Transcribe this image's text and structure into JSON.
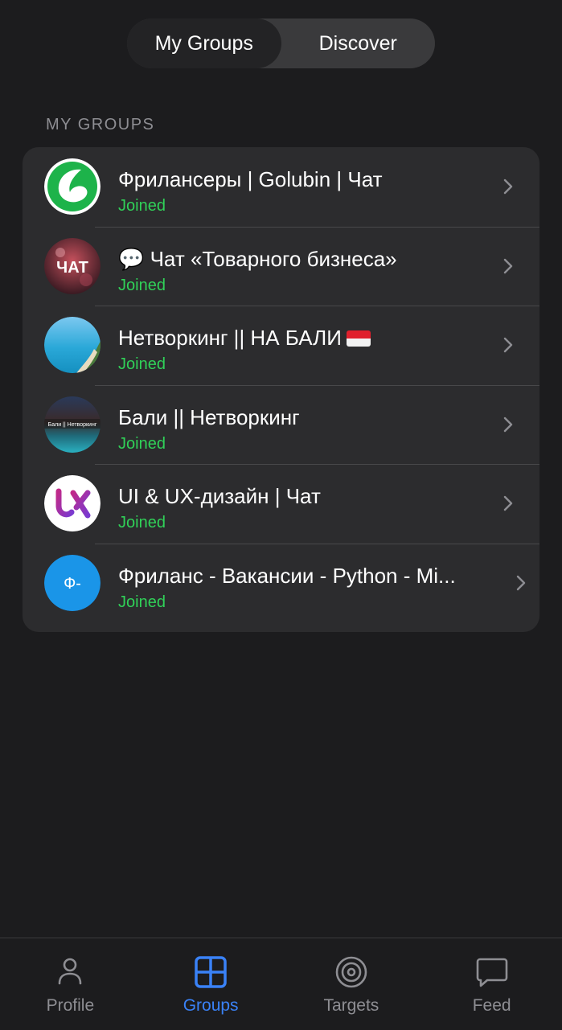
{
  "segmented": {
    "tabs": [
      {
        "label": "My Groups",
        "active": true
      },
      {
        "label": "Discover",
        "active": false
      }
    ]
  },
  "section_header": "MY GROUPS",
  "groups": [
    {
      "title": "Фрилансеры | Golubin | Чат",
      "status": "Joined",
      "avatar": "green-swirl-logo"
    },
    {
      "title": "💬 Чат «Товарного бизнеса»",
      "status": "Joined",
      "avatar": "chat-text-logo",
      "avatar_text": "ЧАТ"
    },
    {
      "title": "Нетворкинг || НА БАЛИ",
      "status": "Joined",
      "avatar": "beach-photo",
      "flag": "indonesia-flag"
    },
    {
      "title": "Бали || Нетворкинг",
      "status": "Joined",
      "avatar": "pool-photo",
      "avatar_text": "Бали || Нетворкинг"
    },
    {
      "title": "UI & UX-дизайн | Чат",
      "status": "Joined",
      "avatar": "ux-logo"
    },
    {
      "title": "Фриланс - Вакансии - Python - Mi...",
      "status": "Joined",
      "avatar": "initials",
      "avatar_text": "Ф-"
    }
  ],
  "tabbar": {
    "items": [
      {
        "label": "Profile",
        "icon": "person-icon",
        "active": false
      },
      {
        "label": "Groups",
        "icon": "grid-icon",
        "active": true
      },
      {
        "label": "Targets",
        "icon": "target-icon",
        "active": false
      },
      {
        "label": "Feed",
        "icon": "chat-bubble-icon",
        "active": false
      }
    ]
  },
  "colors": {
    "background": "#1c1c1e",
    "card": "#2c2c2e",
    "joined_green": "#30d158",
    "accent_blue": "#3a82f7",
    "secondary_text": "#8e8e93"
  }
}
